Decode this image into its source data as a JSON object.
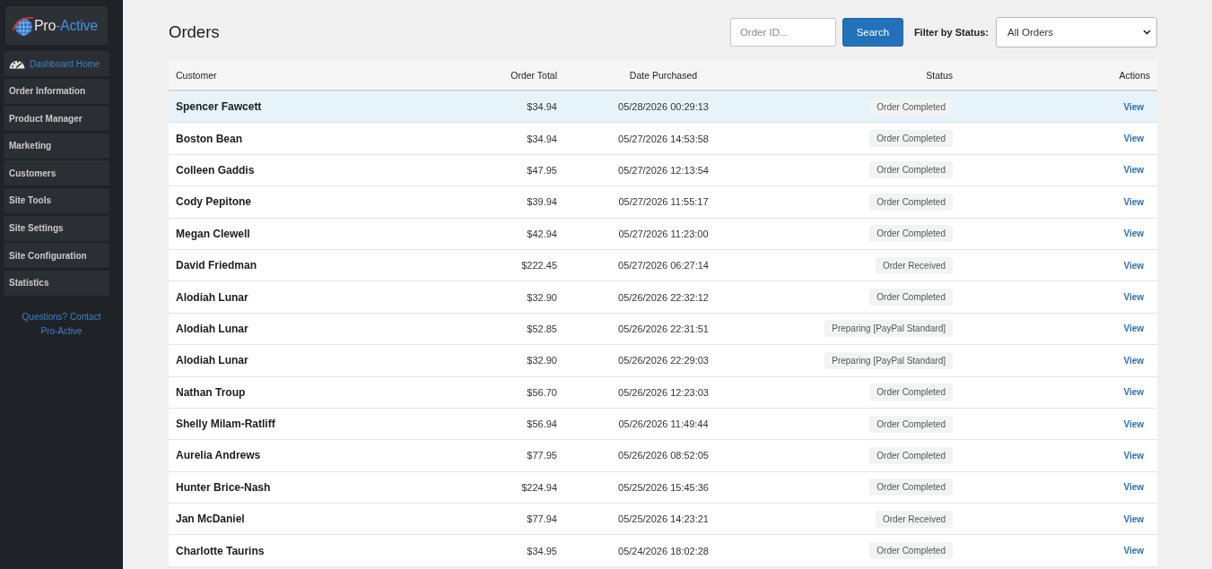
{
  "sidebar": {
    "logo": {
      "words": [
        "Pro",
        "-Active"
      ]
    },
    "items": [
      {
        "label": "Dashboard Home",
        "kind": "link"
      },
      {
        "label": "Order Information",
        "kind": "section"
      },
      {
        "label": "Product Manager",
        "kind": "section"
      },
      {
        "label": "Marketing",
        "kind": "section"
      },
      {
        "label": "Customers",
        "kind": "section"
      },
      {
        "label": "Site Tools",
        "kind": "section"
      },
      {
        "label": "Site Settings",
        "kind": "section"
      },
      {
        "label": "Site Configuration",
        "kind": "section"
      },
      {
        "label": "Statistics",
        "kind": "section"
      }
    ],
    "contact_link": "Questions? Contact Pro-Active"
  },
  "page": {
    "title": "Orders"
  },
  "search": {
    "placeholder": "Order ID...",
    "button": "Search"
  },
  "filter": {
    "label": "Filter by Status:",
    "value": "All Orders"
  },
  "table": {
    "columns": [
      "Customer",
      "Order Total",
      "Date Purchased",
      "Status",
      "Actions"
    ],
    "rows": [
      {
        "customer": "Spencer Fawcett",
        "total": "$34.94",
        "date": "05/28/2026 00:29:13",
        "status": "Order Completed",
        "action": "View",
        "highlighted": true
      },
      {
        "customer": "Boston Bean",
        "total": "$34.94",
        "date": "05/27/2026 14:53:58",
        "status": "Order Completed",
        "action": "View",
        "highlighted": false
      },
      {
        "customer": "Colleen Gaddis",
        "total": "$47.95",
        "date": "05/27/2026 12:13:54",
        "status": "Order Completed",
        "action": "View",
        "highlighted": false
      },
      {
        "customer": "Cody Pepitone",
        "total": "$39.94",
        "date": "05/27/2026 11:55:17",
        "status": "Order Completed",
        "action": "View",
        "highlighted": false
      },
      {
        "customer": "Megan Clewell",
        "total": "$42.94",
        "date": "05/27/2026 11:23:00",
        "status": "Order Completed",
        "action": "View",
        "highlighted": false
      },
      {
        "customer": "David Friedman",
        "total": "$222.45",
        "date": "05/27/2026 06:27:14",
        "status": "Order Received",
        "action": "View",
        "highlighted": false
      },
      {
        "customer": "Alodiah Lunar",
        "total": "$32.90",
        "date": "05/26/2026 22:32:12",
        "status": "Order Completed",
        "action": "View",
        "highlighted": false
      },
      {
        "customer": "Alodiah Lunar",
        "total": "$52.85",
        "date": "05/26/2026 22:31:51",
        "status": "Preparing [PayPal Standard]",
        "action": "View",
        "highlighted": false
      },
      {
        "customer": "Alodiah Lunar",
        "total": "$32.90",
        "date": "05/26/2026 22:29:03",
        "status": "Preparing [PayPal Standard]",
        "action": "View",
        "highlighted": false
      },
      {
        "customer": "Nathan Troup",
        "total": "$56.70",
        "date": "05/26/2026 12:23:03",
        "status": "Order Completed",
        "action": "View",
        "highlighted": false
      },
      {
        "customer": "Shelly Milam-Ratliff",
        "total": "$56.94",
        "date": "05/26/2026 11:49:44",
        "status": "Order Completed",
        "action": "View",
        "highlighted": false
      },
      {
        "customer": "Aurelia Andrews",
        "total": "$77.95",
        "date": "05/26/2026 08:52:05",
        "status": "Order Completed",
        "action": "View",
        "highlighted": false
      },
      {
        "customer": "Hunter Brice-Nash",
        "total": "$224.94",
        "date": "05/25/2026 15:45:36",
        "status": "Order Completed",
        "action": "View",
        "highlighted": false
      },
      {
        "customer": "Jan McDaniel",
        "total": "$77.94",
        "date": "05/25/2026 14:23:21",
        "status": "Order Received",
        "action": "View",
        "highlighted": false
      },
      {
        "customer": "Charlotte Taurins",
        "total": "$34.95",
        "date": "05/24/2026 18:02:28",
        "status": "Order Completed",
        "action": "View",
        "highlighted": false
      }
    ]
  }
}
